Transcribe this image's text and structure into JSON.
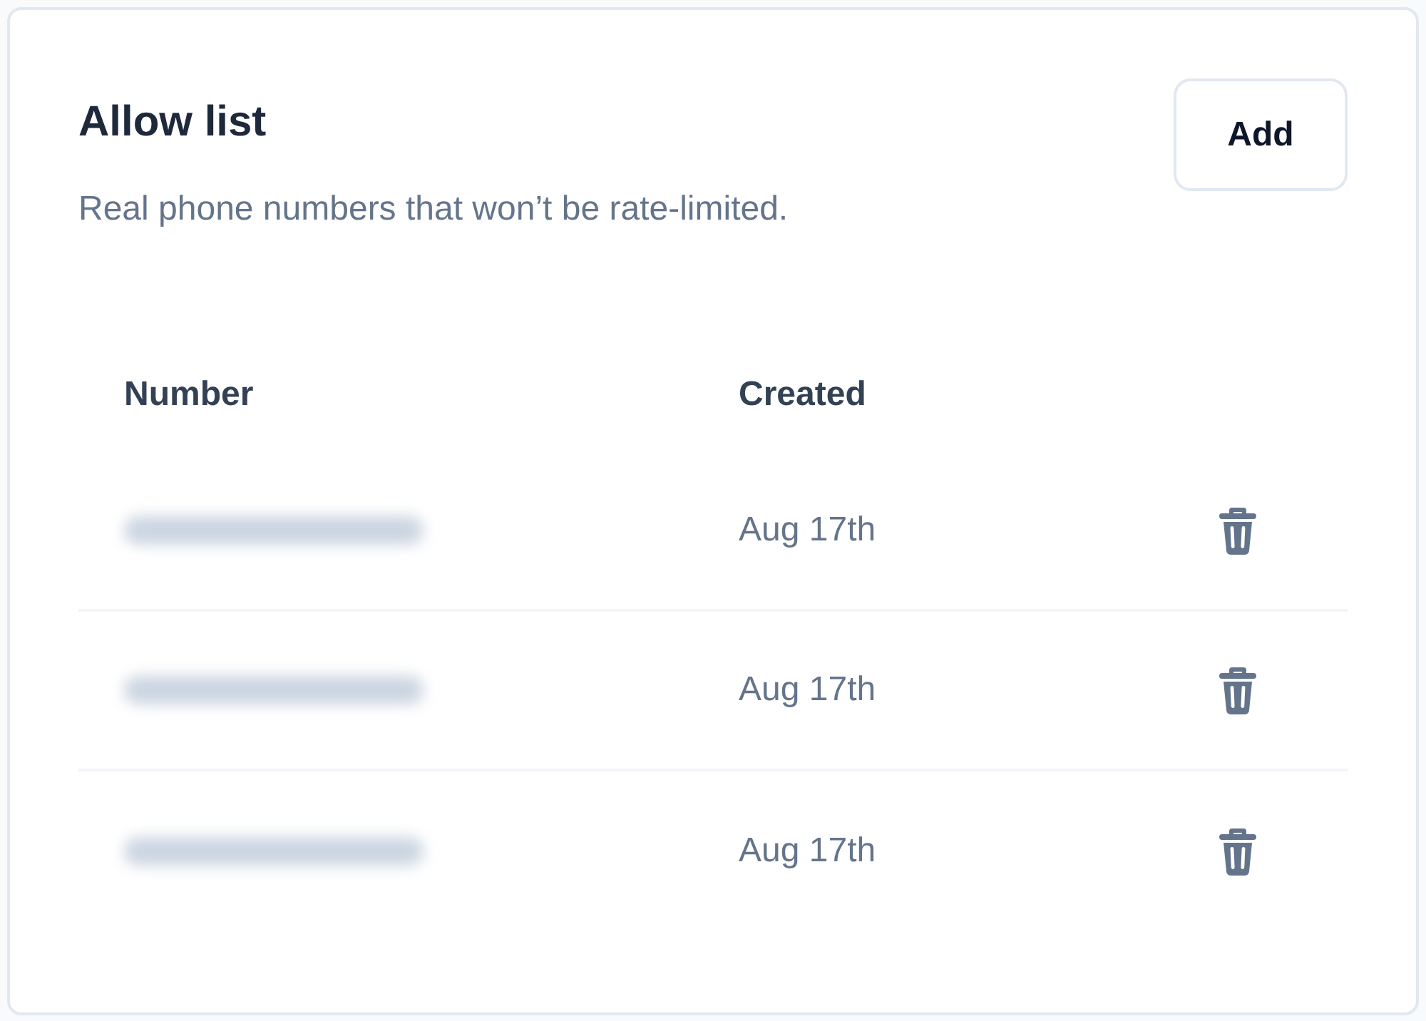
{
  "card": {
    "title": "Allow list",
    "description": "Real phone numbers that won’t be rate-limited.",
    "add_button": "Add"
  },
  "table": {
    "columns": [
      "Number",
      "Created"
    ],
    "rows": [
      {
        "number": {
          "kind": "blurred"
        },
        "created": "Aug 17th"
      },
      {
        "number": {
          "kind": "blurred"
        },
        "created": "Aug 17th"
      },
      {
        "number": {
          "kind": "blurred"
        },
        "created": "Aug 17th"
      }
    ]
  }
}
